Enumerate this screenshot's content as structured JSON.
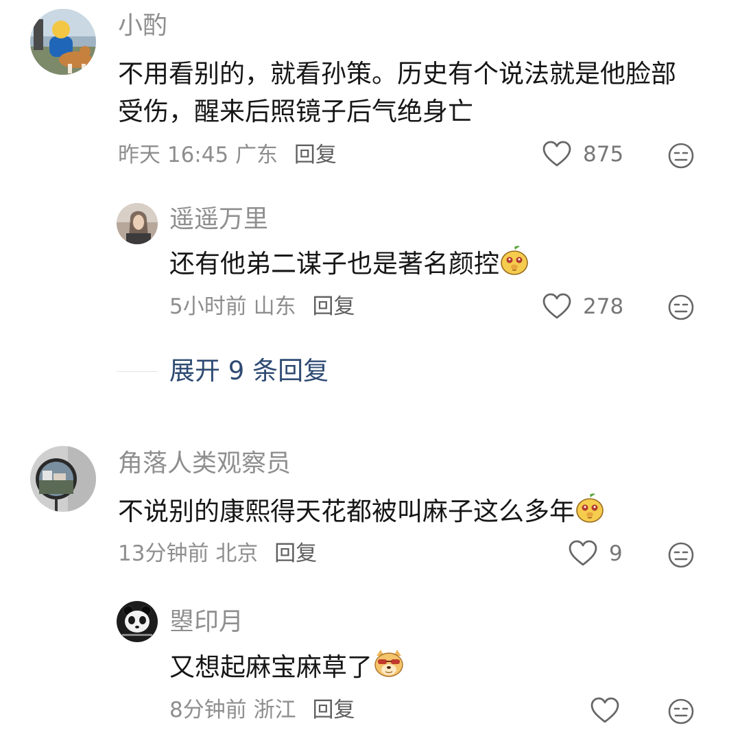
{
  "colors": {
    "text": "#161616",
    "meta": "#8e8e8e",
    "link": "#2e4a73",
    "emoji_yellow": "#f6cc4e"
  },
  "comments": [
    {
      "user": "小酌",
      "text": "不用看别的，就看孙策。历史有个说法就是他脸部受伤，醒来后照镜子后气绝身亡",
      "time": "昨天 16:45",
      "location": "广东",
      "reply_label": "回复",
      "likes": "875",
      "avatar_icon": "avatar-man-with-corgi"
    },
    {
      "user": "遥遥万里",
      "text": "还有他弟二谋子也是著名颜控",
      "emoji": "pear-face-emoji",
      "time": "5小时前",
      "location": "山东",
      "reply_label": "回复",
      "likes": "278",
      "avatar_icon": "avatar-girl-portrait"
    },
    {
      "user": "角落人类观察员",
      "text": "不说别的康熙得天花都被叫麻子这么多年",
      "emoji": "pear-face-emoji",
      "time": "13分钟前",
      "location": "北京",
      "reply_label": "回复",
      "likes": "9",
      "avatar_icon": "avatar-round-mirror"
    },
    {
      "user": "曌印月",
      "text": "又想起麻宝麻草了",
      "emoji": "doge-sunglasses-emoji",
      "time": "8分钟前",
      "location": "浙江",
      "reply_label": "回复",
      "likes": "",
      "avatar_icon": "avatar-panda"
    }
  ],
  "expand": {
    "label": "展开 9 条回复"
  }
}
